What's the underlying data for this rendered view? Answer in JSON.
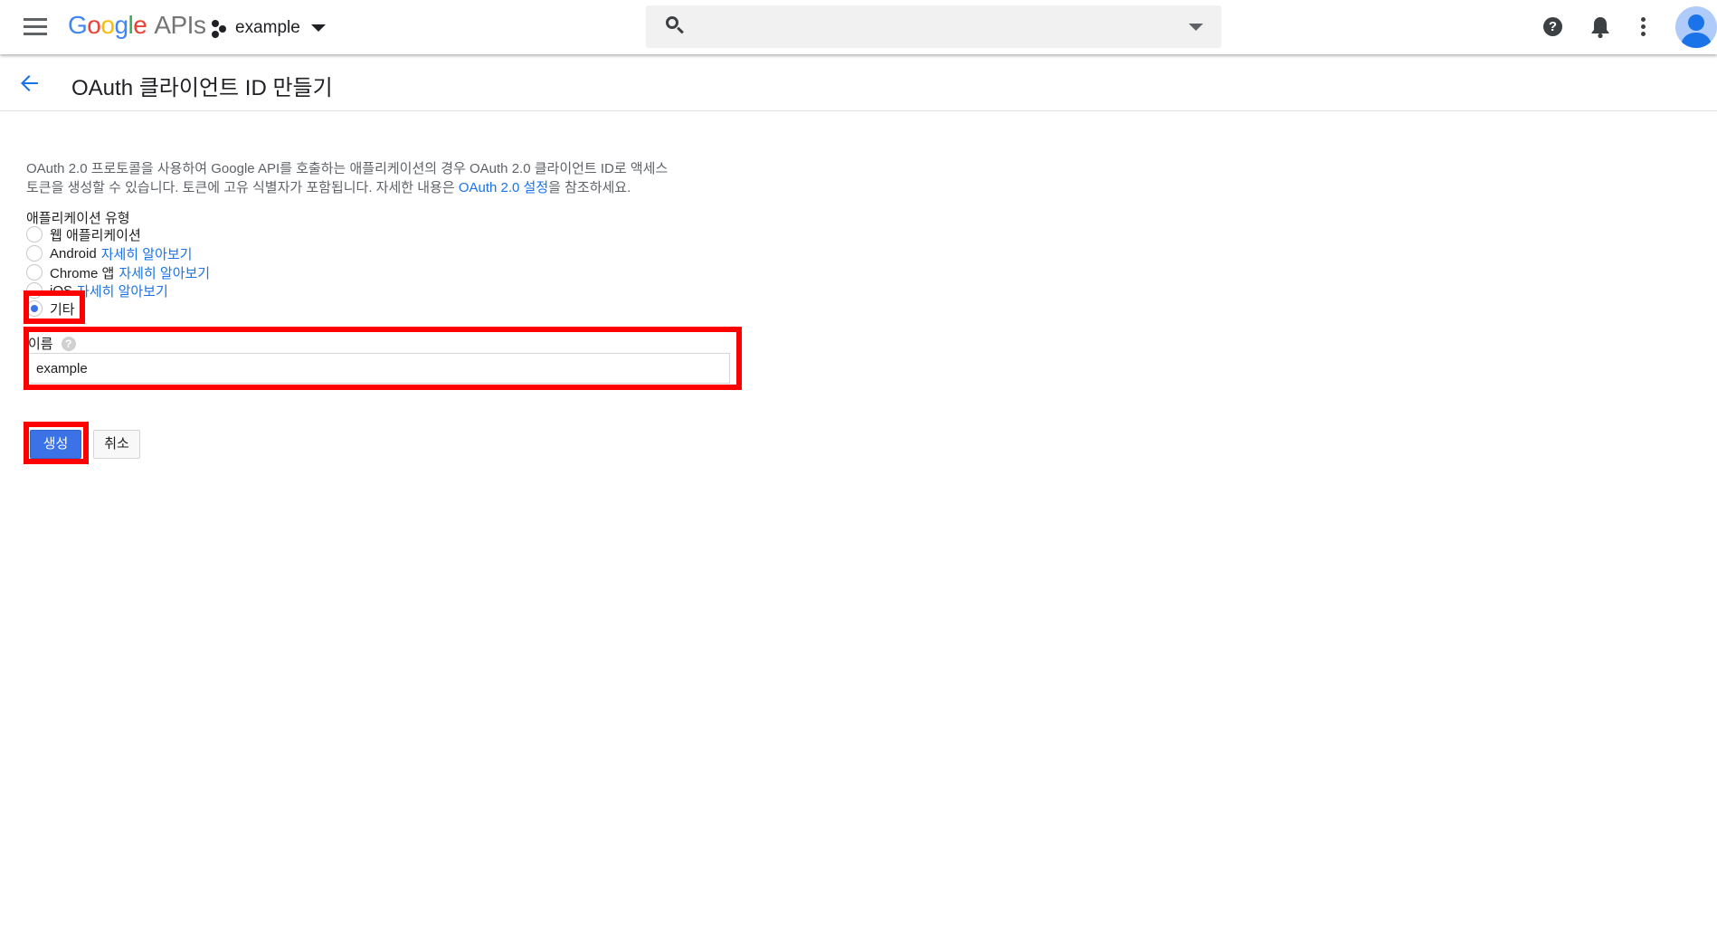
{
  "topbar": {
    "logo": {
      "google_letters": [
        "G",
        "o",
        "o",
        "g",
        "l",
        "e"
      ],
      "apis": "APIs"
    },
    "project_name": "example",
    "search_placeholder": "",
    "icons": [
      "menu-icon",
      "project-icon",
      "search-icon",
      "help-icon",
      "notifications-icon",
      "more-vert-icon",
      "account-icon"
    ]
  },
  "header": {
    "title": "OAuth 클라이언트 ID 만들기"
  },
  "form": {
    "description_line1": "OAuth 2.0 프로토콜을 사용하여 Google API를 호출하는 애플리케이션의 경우 OAuth 2.0 클라이언트 ID로 액세스",
    "description_line2_pre": "토큰을 생성할 수 있습니다. 토큰에 고유 식별자가 포함됩니다. 자세한 내용은",
    "description_link": "OAuth 2.0 설정",
    "description_line2_post": "을 참조하세요.",
    "app_type_label": "애플리케이션 유형",
    "app_types": [
      {
        "label": "웹 애플리케이션",
        "link": "",
        "checked": false
      },
      {
        "label": "Android",
        "link": "자세히 알아보기",
        "checked": false
      },
      {
        "label": "Chrome 앱",
        "link": "자세히 알아보기",
        "checked": false
      },
      {
        "label": "iOS",
        "link": "자세히 알아보기",
        "checked": false
      },
      {
        "label": "기타",
        "link": "",
        "checked": true
      }
    ],
    "name_label": "이름",
    "name_value": "example",
    "create_button": "생성",
    "cancel_button": "취소"
  },
  "colors": {
    "primary": "#3b73e6",
    "link": "#1a73e8",
    "highlight": "#ff0000"
  }
}
